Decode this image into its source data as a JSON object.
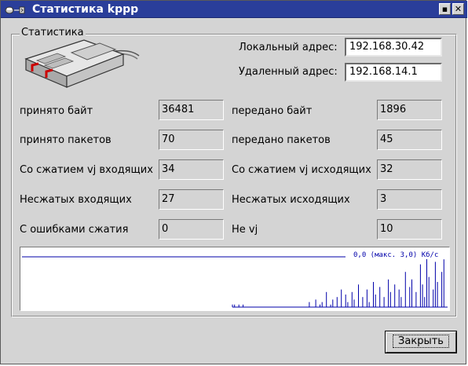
{
  "window": {
    "title": "Статистика kppp",
    "maximize_glyph": "▪",
    "close_glyph": "✕"
  },
  "group": {
    "title": "Статистика"
  },
  "addresses": {
    "local_label": "Локальный адрес:",
    "local_value": "192.168.30.42",
    "remote_label": "Удаленный адрес:",
    "remote_value": "192.168.14.1"
  },
  "stats": {
    "rx_bytes_label": "принято байт",
    "rx_bytes_value": "36481",
    "tx_bytes_label": "передано байт",
    "tx_bytes_value": "1896",
    "rx_packets_label": "принято пакетов",
    "rx_packets_value": "70",
    "tx_packets_label": "передано пакетов",
    "tx_packets_value": "45",
    "vj_in_label": "Со сжатием vj входящих",
    "vj_in_value": "34",
    "vj_out_label": "Со сжатием vj исходящих",
    "vj_out_value": "32",
    "uncompressed_in_label": "Несжатых входящих",
    "uncompressed_in_value": "27",
    "uncompressed_out_label": "Несжатых исходящих",
    "uncompressed_out_value": "3",
    "compress_errors_label": "С ошибками сжатия",
    "compress_errors_value": "0",
    "non_vj_label": "Не vj",
    "non_vj_value": "10"
  },
  "graph": {
    "legend": "0,0 (макс. 3,0) Кб/с",
    "line_color": "#0000aa",
    "bars": [
      0.05,
      0.05,
      0.0,
      0.05,
      0.0,
      0.05,
      0.0,
      0.0,
      0.0,
      0.0,
      0.0,
      0.0,
      0.0,
      0.0,
      0.0,
      0.0,
      0.0,
      0.0,
      0.0,
      0.0,
      0.0,
      0.0,
      0.0,
      0.0,
      0.0,
      0.0,
      0.0,
      0.0,
      0.0,
      0.0,
      0.0,
      0.0,
      0.0,
      0.0,
      0.0,
      0.0,
      0.1,
      0.0,
      0.0,
      0.15,
      0.0,
      0.05,
      0.1,
      0.0,
      0.3,
      0.0,
      0.05,
      0.15,
      0.0,
      0.2,
      0.0,
      0.35,
      0.0,
      0.25,
      0.1,
      0.0,
      0.3,
      0.15,
      0.0,
      0.45,
      0.0,
      0.2,
      0.0,
      0.35,
      0.1,
      0.0,
      0.5,
      0.25,
      0.0,
      0.4,
      0.0,
      0.2,
      0.0,
      0.55,
      0.3,
      0.0,
      0.45,
      0.0,
      0.35,
      0.2,
      0.0,
      0.7,
      0.0,
      0.4,
      0.55,
      0.0,
      0.3,
      0.0,
      0.85,
      0.45,
      0.2,
      1.0,
      0.6,
      0.0,
      0.35,
      0.9,
      0.5,
      0.0,
      0.7,
      0.95
    ]
  },
  "buttons": {
    "close_label": "Закрыть"
  }
}
